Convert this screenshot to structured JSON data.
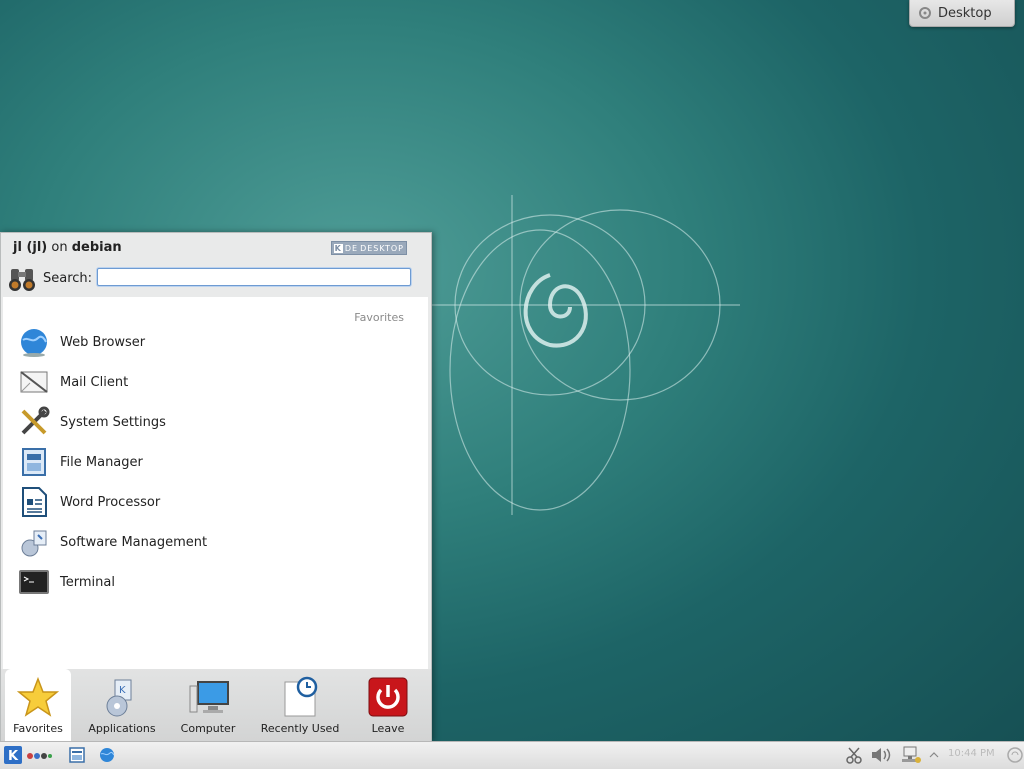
{
  "desktop_button": {
    "label": "Desktop",
    "icon": "desktop-icon"
  },
  "menu": {
    "user_name": "jl (jl)",
    "on_word": "on",
    "host": "debian",
    "badge": {
      "k": "K",
      "de": "DE",
      "desktop": "DESKTOP"
    },
    "search_label": "Search:",
    "search_value": "",
    "section_caption": "Favorites",
    "favorites": [
      {
        "label": "Web Browser",
        "icon": "globe-icon"
      },
      {
        "label": "Mail Client",
        "icon": "mail-icon"
      },
      {
        "label": "System Settings",
        "icon": "settings-tools-icon"
      },
      {
        "label": "File Manager",
        "icon": "file-manager-icon"
      },
      {
        "label": "Word Processor",
        "icon": "document-icon"
      },
      {
        "label": "Software Management",
        "icon": "package-icon"
      },
      {
        "label": "Terminal",
        "icon": "terminal-icon"
      }
    ],
    "tabs": [
      {
        "label": "Favorites",
        "icon": "star-icon",
        "active": true
      },
      {
        "label": "Applications",
        "icon": "applications-icon",
        "active": false
      },
      {
        "label": "Computer",
        "icon": "computer-icon",
        "active": false
      },
      {
        "label": "Recently Used",
        "icon": "clock-icon",
        "active": false
      },
      {
        "label": "Leave",
        "icon": "power-icon",
        "active": false
      }
    ]
  },
  "taskbar": {
    "clock": "10:44 PM",
    "icons": [
      "kde-menu-icon",
      "activities-icon",
      "show-desktop-icon",
      "browser-icon",
      "scissors-icon",
      "volume-icon",
      "network-icon",
      "notifications-arrow-icon",
      "cashew-icon"
    ]
  },
  "colors": {
    "desktop_bg": "#2f7f7b",
    "accent": "#6e9bd2",
    "leave_red": "#c8161b"
  }
}
